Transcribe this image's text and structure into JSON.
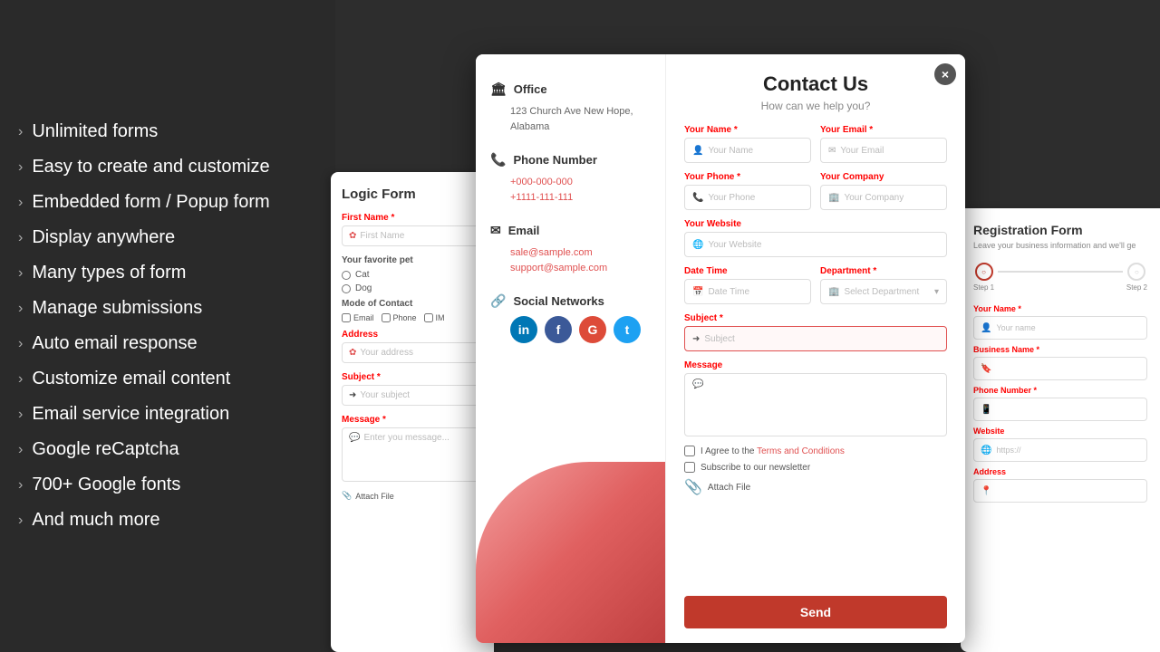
{
  "features": {
    "items": [
      {
        "label": "Unlimited forms"
      },
      {
        "label": "Easy to create and customize"
      },
      {
        "label": "Embedded form / Popup form"
      },
      {
        "label": "Display anywhere"
      },
      {
        "label": "Many types of form"
      },
      {
        "label": "Manage submissions"
      },
      {
        "label": "Auto email response"
      },
      {
        "label": "Customize email content"
      },
      {
        "label": "Email service integration"
      },
      {
        "label": "Google reCaptcha"
      },
      {
        "label": "700+ Google fonts"
      },
      {
        "label": "And much more"
      }
    ]
  },
  "logic_form": {
    "title": "Logic Form",
    "first_name_label": "First Name",
    "first_name_placeholder": "First Name",
    "pet_label": "Your favorite pet",
    "pet_options": [
      "Cat",
      "Dog"
    ],
    "mode_label": "Mode of Contact",
    "mode_options": [
      "Email",
      "Phone",
      "IM"
    ],
    "address_label": "Address",
    "address_placeholder": "Your address",
    "subject_label": "Subject",
    "subject_placeholder": "Your subject",
    "message_label": "Message",
    "message_placeholder": "Enter you message...",
    "attach_label": "Attach File"
  },
  "contact_modal": {
    "title": "Contact Us",
    "subtitle": "How can we help you?",
    "close_label": "×",
    "office": {
      "title": "Office",
      "address": "123 Church Ave New Hope, Alabama"
    },
    "phone": {
      "title": "Phone Number",
      "numbers": [
        "+000-000-000",
        "+1111-111-111"
      ]
    },
    "email": {
      "title": "Email",
      "addresses": [
        "sale@sample.com",
        "support@sample.com"
      ]
    },
    "social": {
      "title": "Social Networks",
      "networks": [
        "LinkedIn",
        "Facebook",
        "Google",
        "Twitter"
      ]
    },
    "form": {
      "your_name_label": "Your Name",
      "your_name_placeholder": "Your Name",
      "your_email_label": "Your Email",
      "your_email_placeholder": "Your Email",
      "your_phone_label": "Your Phone",
      "your_phone_placeholder": "Your Phone",
      "your_company_label": "Your Company",
      "your_company_placeholder": "Your Company",
      "your_website_label": "Your Website",
      "your_website_placeholder": "Your Website",
      "date_time_label": "Date Time",
      "date_time_placeholder": "Date Time",
      "department_label": "Department",
      "department_placeholder": "Select Department",
      "subject_label": "Subject",
      "subject_placeholder": "Subject",
      "message_label": "Message",
      "terms_label": "I Agree to the",
      "terms_link": "Terms and Conditions",
      "newsletter_label": "Subscribe to our newsletter",
      "attach_label": "Attach File",
      "send_button": "Send"
    }
  },
  "registration_form": {
    "title": "Registration Form",
    "subtitle": "Leave your business information and we'll ge",
    "step1_label": "Step 1",
    "step2_label": "Step 2",
    "your_name_label": "Your Name",
    "your_name_placeholder": "Your name",
    "business_name_label": "Business Name",
    "phone_label": "Phone Number",
    "website_label": "Website",
    "website_placeholder": "https://",
    "address_label": "Address"
  }
}
